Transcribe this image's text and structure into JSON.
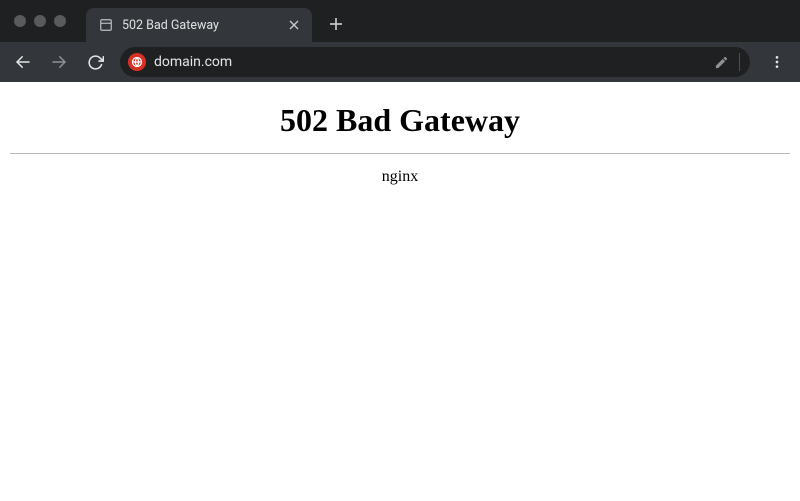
{
  "tab": {
    "title": "502 Bad Gateway"
  },
  "address": {
    "url": "domain.com"
  },
  "page": {
    "heading": "502 Bad Gateway",
    "server": "nginx"
  }
}
